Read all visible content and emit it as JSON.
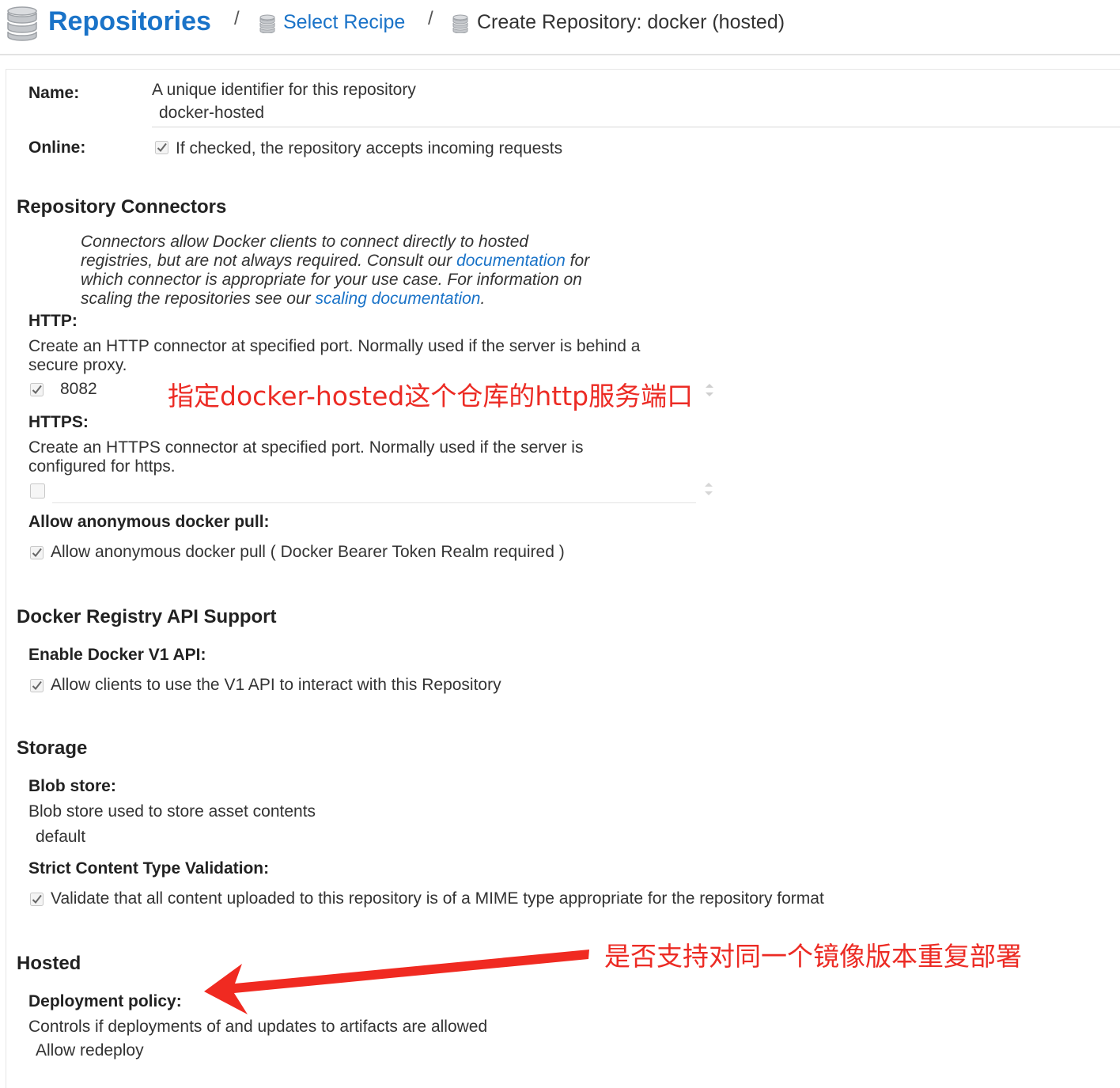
{
  "header": {
    "title": "Repositories",
    "sep": "/",
    "crumb_recipe": "Select Recipe",
    "crumb_current": "Create Repository: docker (hosted)"
  },
  "name_field": {
    "label": "Name:",
    "help": "A unique identifier for this repository",
    "value": "docker-hosted"
  },
  "online_field": {
    "label": "Online:",
    "checkbox_text": "If checked, the repository accepts incoming requests",
    "checked": true
  },
  "connectors": {
    "heading": "Repository Connectors",
    "desc_l1": "Connectors allow Docker clients to connect directly to hosted",
    "desc_l2a": "registries, but are not always required. Consult our ",
    "desc_l2_link": "documentation",
    "desc_l2b": " for",
    "desc_l3": "which connector is appropriate for your use case. For information on",
    "desc_l4a": "scaling the repositories see our ",
    "desc_l4_link": "scaling documentation",
    "desc_l4b": ".",
    "http_label": "HTTP:",
    "http_desc_l1": "Create an HTTP connector at specified port. Normally used if the server is behind a",
    "http_desc_l2": "secure proxy.",
    "http_port": "8082",
    "http_checked": true,
    "https_label": "HTTPS:",
    "https_desc_l1": "Create an HTTPS connector at specified port. Normally used if the server is",
    "https_desc_l2": "configured for https.",
    "https_port": "",
    "https_checked": false,
    "anon_label": "Allow anonymous docker pull:",
    "anon_text": "Allow anonymous docker pull ( Docker Bearer Token Realm required )",
    "anon_checked": true
  },
  "api": {
    "heading": "Docker Registry API Support",
    "v1_label": "Enable Docker V1 API:",
    "v1_text": "Allow clients to use the V1 API to interact with this Repository",
    "v1_checked": true
  },
  "storage": {
    "heading": "Storage",
    "blob_label": "Blob store:",
    "blob_help": "Blob store used to store asset contents",
    "blob_value": "default",
    "strict_label": "Strict Content Type Validation:",
    "strict_text": "Validate that all content uploaded to this repository is of a MIME type appropriate for the repository format",
    "strict_checked": true
  },
  "hosted": {
    "heading": "Hosted",
    "policy_label": "Deployment policy:",
    "policy_help": "Controls if deployments of and updates to artifacts are allowed",
    "policy_value": "Allow redeploy"
  },
  "annotations": {
    "http_note": "指定docker-hosted这个仓库的http服务端口",
    "redeploy_note": "是否支持对同一个镜像版本重复部署"
  },
  "colors": {
    "link": "#1a73c8",
    "annotation": "#ec2b24"
  }
}
